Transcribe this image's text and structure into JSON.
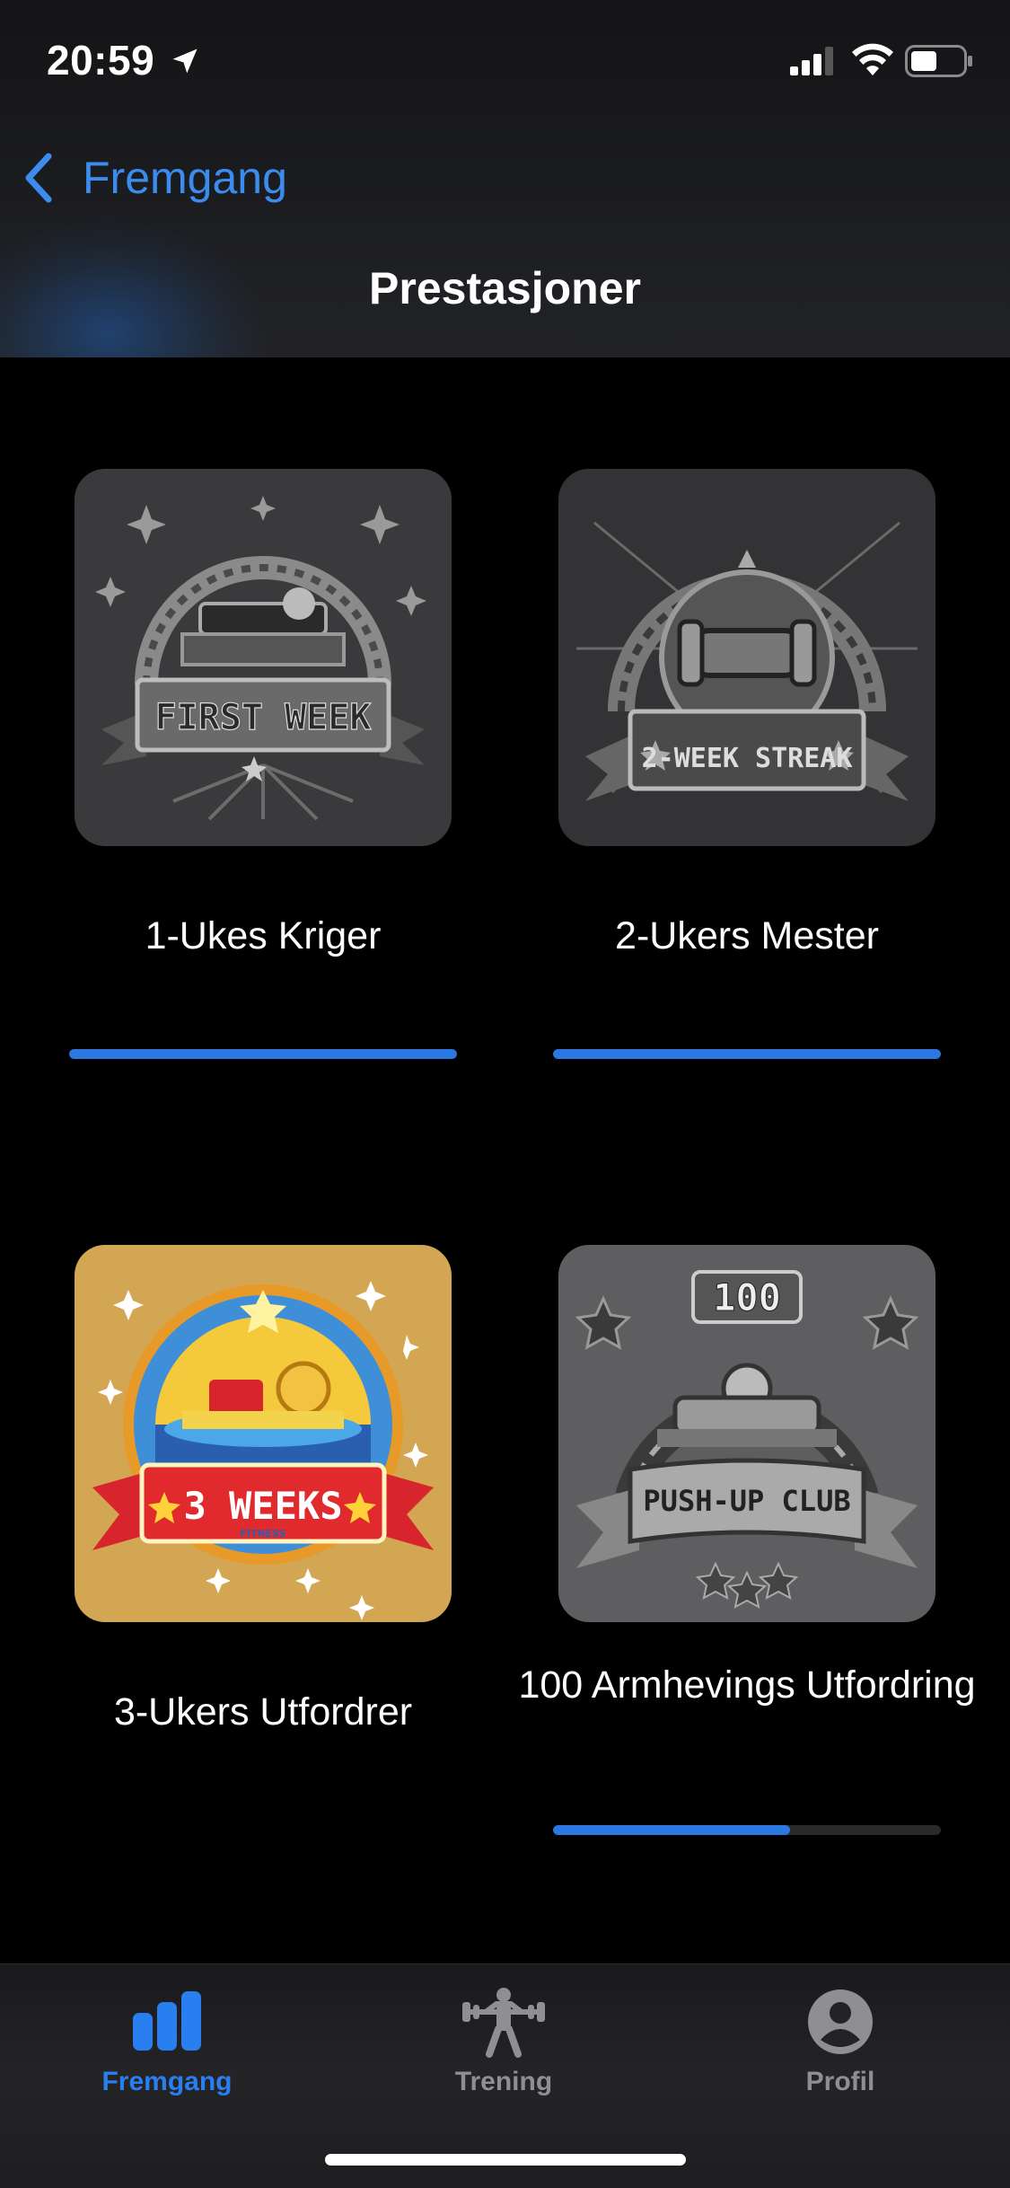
{
  "status_bar": {
    "time": "20:59",
    "icons": [
      "location-arrow-icon",
      "cellular-signal-icon",
      "wifi-icon",
      "battery-icon"
    ]
  },
  "nav": {
    "back_label": "Fremgang",
    "title": "Prestasjoner"
  },
  "colors": {
    "accent": "#3c8cf0",
    "progress": "#2a78e0",
    "background": "#000000",
    "tab_inactive": "#8e8e93"
  },
  "achievements": [
    {
      "title": "1-Ukes Kriger",
      "badge_text": "FIRST WEEK",
      "unlocked": false,
      "progress": 1.0
    },
    {
      "title": "2-Ukers Mester",
      "badge_text": "2-WEEK STREAK",
      "unlocked": false,
      "progress": 1.0
    },
    {
      "title": "3-Ukers Utfordrer",
      "badge_text": "3 WEEKS",
      "badge_subtext": "FITNESS",
      "unlocked": true,
      "progress": null
    },
    {
      "title": "100 Armhevings Utfordring",
      "badge_text": "PUSH-UP CLUB",
      "badge_number": "100",
      "unlocked": false,
      "progress": 0.61
    }
  ],
  "tabbar": {
    "tabs": [
      {
        "label": "Fremgang",
        "icon": "bar-chart-icon",
        "active": true
      },
      {
        "label": "Trening",
        "icon": "weightlifter-icon",
        "active": false
      },
      {
        "label": "Profil",
        "icon": "person-circle-icon",
        "active": false
      }
    ]
  }
}
